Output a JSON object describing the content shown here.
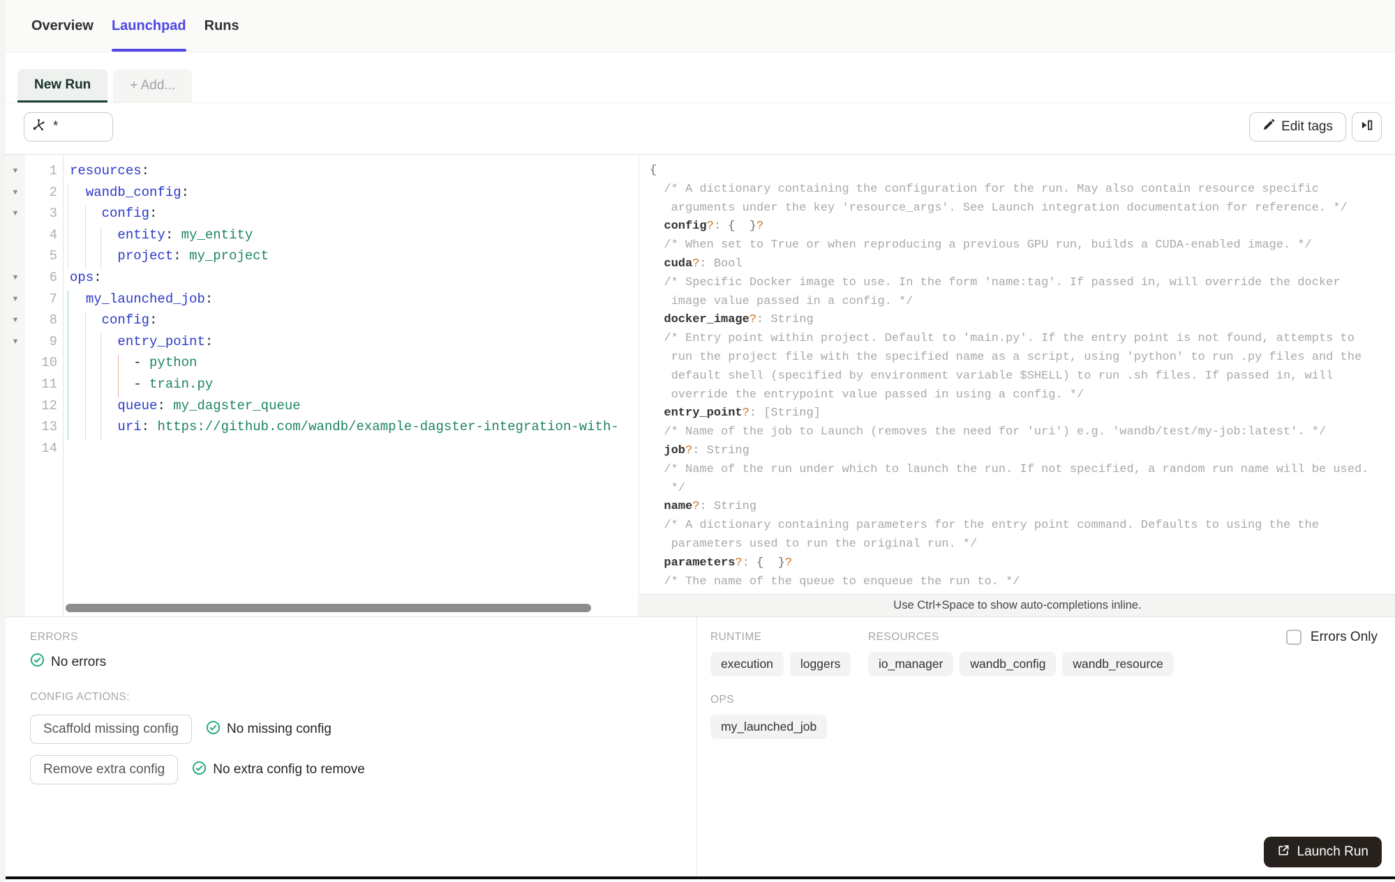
{
  "tabs": {
    "overview": "Overview",
    "launchpad": "Launchpad",
    "runs": "Runs"
  },
  "subtabs": {
    "new_run": "New Run",
    "add": "+ Add..."
  },
  "toolbar": {
    "op_selector_value": "*",
    "edit_tags_label": "Edit tags"
  },
  "editor": {
    "lines": [
      {
        "n": 1,
        "fold": true,
        "segs": [
          [
            "yk",
            "resources"
          ],
          [
            "ypl",
            ":"
          ]
        ]
      },
      {
        "n": 2,
        "fold": true,
        "segs": [
          [
            "ypl",
            "  "
          ],
          [
            "yk",
            "wandb_config"
          ],
          [
            "ypl",
            ":"
          ]
        ]
      },
      {
        "n": 3,
        "fold": true,
        "segs": [
          [
            "ypl",
            "    "
          ],
          [
            "yk",
            "config"
          ],
          [
            "ypl",
            ":"
          ]
        ]
      },
      {
        "n": 4,
        "fold": false,
        "segs": [
          [
            "ypl",
            "      "
          ],
          [
            "yk",
            "entity"
          ],
          [
            "ypl",
            ": "
          ],
          [
            "yv",
            "my_entity"
          ]
        ]
      },
      {
        "n": 5,
        "fold": false,
        "segs": [
          [
            "ypl",
            "      "
          ],
          [
            "yk",
            "project"
          ],
          [
            "ypl",
            ": "
          ],
          [
            "yv",
            "my_project"
          ]
        ]
      },
      {
        "n": 6,
        "fold": true,
        "segs": [
          [
            "yk",
            "ops"
          ],
          [
            "ypl",
            ":"
          ]
        ]
      },
      {
        "n": 7,
        "fold": true,
        "segs": [
          [
            "ypl",
            "  "
          ],
          [
            "yk",
            "my_launched_job"
          ],
          [
            "ypl",
            ":"
          ]
        ]
      },
      {
        "n": 8,
        "fold": true,
        "segs": [
          [
            "ypl",
            "    "
          ],
          [
            "yk",
            "config"
          ],
          [
            "ypl",
            ":"
          ]
        ]
      },
      {
        "n": 9,
        "fold": true,
        "segs": [
          [
            "ypl",
            "      "
          ],
          [
            "yk",
            "entry_point"
          ],
          [
            "ypl",
            ":"
          ]
        ]
      },
      {
        "n": 10,
        "fold": false,
        "segs": [
          [
            "ypl",
            "        - "
          ],
          [
            "yv",
            "python"
          ]
        ]
      },
      {
        "n": 11,
        "fold": false,
        "segs": [
          [
            "ypl",
            "        - "
          ],
          [
            "yv",
            "train.py"
          ]
        ]
      },
      {
        "n": 12,
        "fold": false,
        "segs": [
          [
            "ypl",
            "      "
          ],
          [
            "yk",
            "queue"
          ],
          [
            "ypl",
            ": "
          ],
          [
            "yv",
            "my_dagster_queue"
          ]
        ]
      },
      {
        "n": 13,
        "fold": false,
        "segs": [
          [
            "ypl",
            "      "
          ],
          [
            "yk",
            "uri"
          ],
          [
            "ypl",
            ": "
          ],
          [
            "yv",
            "https://github.com/wandb/example-dagster-integration-with-"
          ]
        ]
      },
      {
        "n": 14,
        "fold": false,
        "segs": [
          [
            "ypl",
            ""
          ]
        ]
      }
    ]
  },
  "schema": {
    "hint": "Use Ctrl+Space to show auto-completions inline.",
    "lines": [
      [
        [
          "sb",
          "{"
        ]
      ],
      [
        [
          "sc",
          "  /* A dictionary containing the configuration for the run. May also contain resource specific"
        ]
      ],
      [
        [
          "sc",
          "   arguments under the key 'resource_args'. See Launch integration documentation for reference. */"
        ]
      ],
      [
        [
          "sk",
          "  config"
        ],
        [
          "sq",
          "?"
        ],
        [
          "sp",
          ": "
        ],
        [
          "sb",
          "{  }"
        ],
        [
          "sq",
          "?"
        ]
      ],
      [
        [
          "sc",
          "  /* When set to True or when reproducing a previous GPU run, builds a CUDA-enabled image. */"
        ]
      ],
      [
        [
          "sk",
          "  cuda"
        ],
        [
          "sq",
          "?"
        ],
        [
          "sp",
          ": "
        ],
        [
          "st",
          "Bool"
        ]
      ],
      [
        [
          "sc",
          "  /* Specific Docker image to use. In the form 'name:tag'. If passed in, will override the docker"
        ]
      ],
      [
        [
          "sc",
          "   image value passed in a config. */"
        ]
      ],
      [
        [
          "sk",
          "  docker_image"
        ],
        [
          "sq",
          "?"
        ],
        [
          "sp",
          ": "
        ],
        [
          "st",
          "String"
        ]
      ],
      [
        [
          "sc",
          "  /* Entry point within project. Default to 'main.py'. If the entry point is not found, attempts to"
        ]
      ],
      [
        [
          "sc",
          "   run the project file with the specified name as a script, using 'python' to run .py files and the"
        ]
      ],
      [
        [
          "sc",
          "   default shell (specified by environment variable $SHELL) to run .sh files. If passed in, will"
        ]
      ],
      [
        [
          "sc",
          "   override the entrypoint value passed in using a config. */"
        ]
      ],
      [
        [
          "sk",
          "  entry_point"
        ],
        [
          "sq",
          "?"
        ],
        [
          "sp",
          ": "
        ],
        [
          "st",
          "[String]"
        ]
      ],
      [
        [
          "sc",
          "  /* Name of the job to Launch (removes the need for 'uri') e.g. 'wandb/test/my-job:latest'. */"
        ]
      ],
      [
        [
          "sk",
          "  job"
        ],
        [
          "sq",
          "?"
        ],
        [
          "sp",
          ": "
        ],
        [
          "st",
          "String"
        ]
      ],
      [
        [
          "sc",
          "  /* Name of the run under which to launch the run. If not specified, a random run name will be used."
        ]
      ],
      [
        [
          "sc",
          "   */"
        ]
      ],
      [
        [
          "sk",
          "  name"
        ],
        [
          "sq",
          "?"
        ],
        [
          "sp",
          ": "
        ],
        [
          "st",
          "String"
        ]
      ],
      [
        [
          "sc",
          "  /* A dictionary containing parameters for the entry point command. Defaults to using the the"
        ]
      ],
      [
        [
          "sc",
          "   parameters used to run the original run. */"
        ]
      ],
      [
        [
          "sk",
          "  parameters"
        ],
        [
          "sq",
          "?"
        ],
        [
          "sp",
          ": "
        ],
        [
          "sb",
          "{  }"
        ],
        [
          "sq",
          "?"
        ]
      ],
      [
        [
          "sc",
          "  /* The name of the queue to enqueue the run to. */"
        ]
      ]
    ]
  },
  "bottom": {
    "errors": {
      "label": "ERRORS",
      "status": "No errors"
    },
    "config_actions": {
      "label": "CONFIG ACTIONS:",
      "scaffold_button": "Scaffold missing config",
      "scaffold_status": "No missing config",
      "remove_button": "Remove extra config",
      "remove_status": "No extra config to remove"
    },
    "errors_only_label": "Errors Only",
    "runtime": {
      "label": "RUNTIME",
      "chips": [
        "execution",
        "loggers"
      ]
    },
    "resources": {
      "label": "RESOURCES",
      "chips": [
        "io_manager",
        "wandb_config",
        "wandb_resource"
      ]
    },
    "ops": {
      "label": "OPS",
      "chips": [
        "my_launched_job"
      ]
    },
    "launch_button": "Launch Run"
  },
  "colors": {
    "accent": "#4e45e4",
    "active_tab_underline": "#1c4037",
    "success": "#21a874",
    "launch_bg": "#26211d"
  }
}
